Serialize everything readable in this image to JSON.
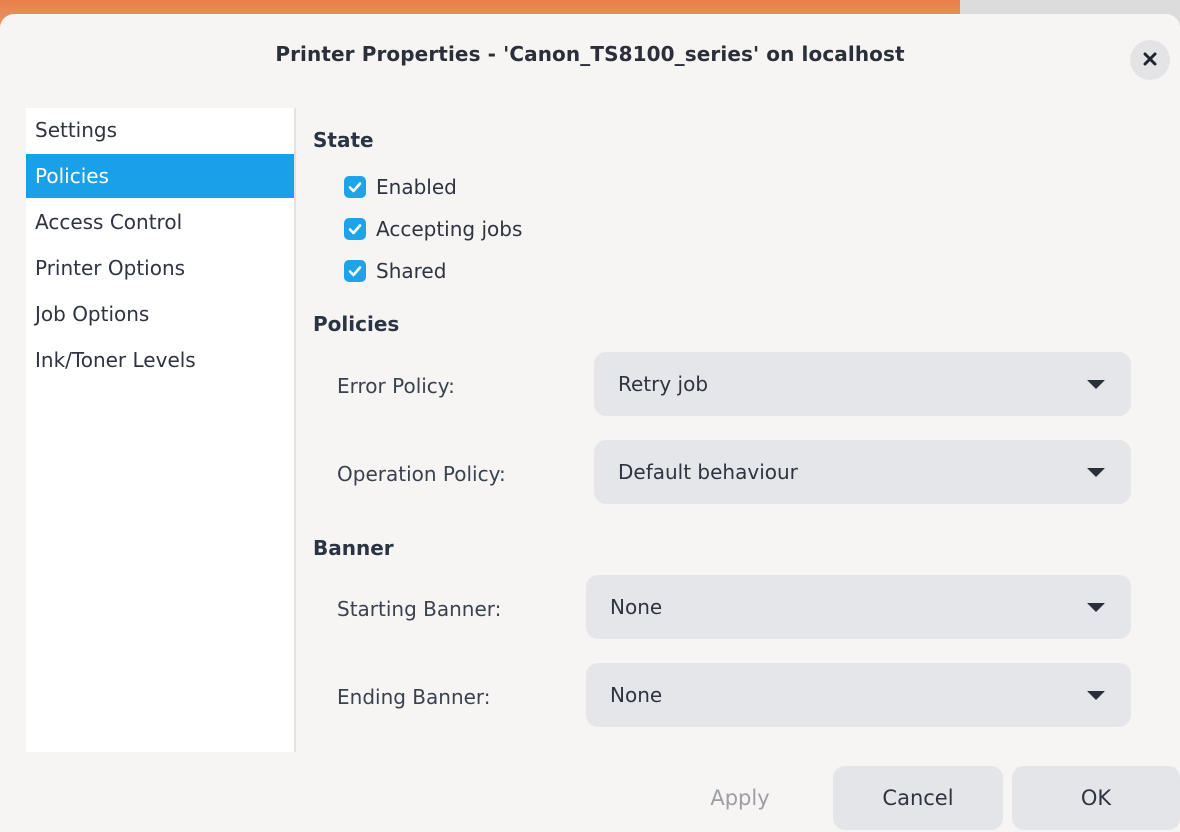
{
  "window": {
    "title": "Printer Properties - 'Canon_TS8100_series' on localhost",
    "close_icon": "close-icon"
  },
  "sidebar": {
    "items": [
      {
        "label": "Settings",
        "selected": false
      },
      {
        "label": "Policies",
        "selected": true
      },
      {
        "label": "Access Control",
        "selected": false
      },
      {
        "label": "Printer Options",
        "selected": false
      },
      {
        "label": "Job Options",
        "selected": false
      },
      {
        "label": "Ink/Toner Levels",
        "selected": false
      }
    ]
  },
  "state": {
    "heading": "State",
    "enabled": {
      "label": "Enabled",
      "checked": true
    },
    "accepting_jobs": {
      "label": "Accepting jobs",
      "checked": true
    },
    "shared": {
      "label": "Shared",
      "checked": true
    }
  },
  "policies": {
    "heading": "Policies",
    "error_policy": {
      "label": "Error Policy:",
      "value": "Retry job"
    },
    "operation_policy": {
      "label": "Operation Policy:",
      "value": "Default behaviour"
    }
  },
  "banner": {
    "heading": "Banner",
    "starting": {
      "label": "Starting Banner:",
      "value": "None"
    },
    "ending": {
      "label": "Ending Banner:",
      "value": "None"
    }
  },
  "buttons": {
    "apply": "Apply",
    "cancel": "Cancel",
    "ok": "OK"
  },
  "colors": {
    "accent": "#1aa0e6",
    "checkbox": "#1ea3e8",
    "dialog_bg": "#f6f5f4",
    "dropdown_bg": "#e5e6e9"
  }
}
